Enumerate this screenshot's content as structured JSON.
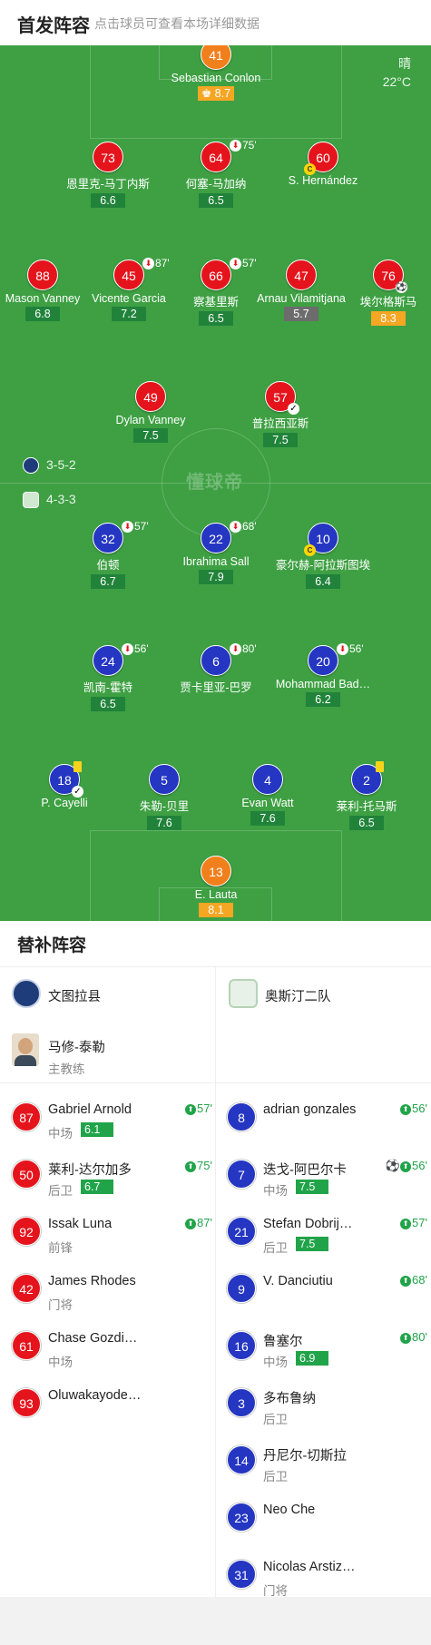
{
  "header": {
    "title": "首发阵容",
    "subtitle": "点击球员可查看本场详细数据"
  },
  "weather": {
    "condition": "晴",
    "temperature": "22°C"
  },
  "watermark": "懂球帝",
  "formations": {
    "home": "3-5-2",
    "away": "4-3-3"
  },
  "home_players": [
    {
      "num": "41",
      "name": "Sebastian Conlon",
      "rating": "8.7"
    },
    {
      "num": "73",
      "name": "恩里克-马丁内斯",
      "rating": "6.6"
    },
    {
      "num": "64",
      "name": "何塞-马加纳",
      "rating": "6.5",
      "sub": "75'"
    },
    {
      "num": "60",
      "name": "S. Hernández"
    },
    {
      "num": "88",
      "name": "Mason Vanney",
      "rating": "6.8"
    },
    {
      "num": "45",
      "name": "Vicente Garcia",
      "rating": "7.2",
      "sub": "87'"
    },
    {
      "num": "66",
      "name": "察基里斯",
      "rating": "6.5",
      "sub": "57'"
    },
    {
      "num": "47",
      "name": "Arnau Vilamitjana",
      "rating": "5.7"
    },
    {
      "num": "76",
      "name": "埃尔格斯马",
      "rating": "8.3"
    },
    {
      "num": "49",
      "name": "Dylan Vanney",
      "rating": "7.5"
    },
    {
      "num": "57",
      "name": "普拉西亚斯",
      "rating": "7.5"
    }
  ],
  "away_players": [
    {
      "num": "32",
      "name": "伯顿",
      "rating": "6.7",
      "sub": "57'"
    },
    {
      "num": "22",
      "name": "Ibrahima Sall",
      "rating": "7.9",
      "sub": "68'"
    },
    {
      "num": "10",
      "name": "豪尔赫-阿拉斯图埃",
      "rating": "6.4"
    },
    {
      "num": "24",
      "name": "凯南-霍特",
      "rating": "6.5",
      "sub": "56'"
    },
    {
      "num": "6",
      "name": "贾卡里亚-巴罗",
      "sub": "80'"
    },
    {
      "num": "20",
      "name": "Mohammad Bad…",
      "rating": "6.2",
      "sub": "56'"
    },
    {
      "num": "18",
      "name": "P. Cayelli"
    },
    {
      "num": "5",
      "name": "朱勒-贝里",
      "rating": "7.6"
    },
    {
      "num": "4",
      "name": "Evan Watt",
      "rating": "7.6"
    },
    {
      "num": "2",
      "name": "莱利-托马斯",
      "rating": "6.5"
    },
    {
      "num": "13",
      "name": "E. Lauta",
      "rating": "8.1"
    }
  ],
  "captain_mark": "C",
  "subs": {
    "title": "替补阵容",
    "home_team": "文图拉县",
    "away_team": "奥斯汀二队",
    "coach": {
      "name": "马修-泰勒",
      "role": "主教练"
    },
    "home": [
      {
        "num": "87",
        "name": "Gabriel Arnold",
        "pos": "中场",
        "rating": "6.1",
        "min": "57'"
      },
      {
        "num": "50",
        "name": "莱利-达尔加多",
        "pos": "后卫",
        "rating": "6.7",
        "min": "75'"
      },
      {
        "num": "92",
        "name": "Issak Luna",
        "pos": "前锋",
        "min": "87'"
      },
      {
        "num": "42",
        "name": "James Rhodes",
        "pos": "门将"
      },
      {
        "num": "61",
        "name": "Chase Gozdi…",
        "pos": "中场"
      },
      {
        "num": "93",
        "name": "Oluwakayode…"
      }
    ],
    "away": [
      {
        "num": "8",
        "name": "adrian gonzales",
        "min": "56'"
      },
      {
        "num": "7",
        "name": "迭戈-阿巴尔卡",
        "pos": "中场",
        "rating": "7.5",
        "min": "56'"
      },
      {
        "num": "21",
        "name": "Stefan Dobrij…",
        "pos": "后卫",
        "rating": "7.5",
        "min": "57'"
      },
      {
        "num": "9",
        "name": "V. Danciutiu",
        "min": "68'"
      },
      {
        "num": "16",
        "name": "鲁塞尔",
        "pos": "中场",
        "rating": "6.9",
        "min": "80'"
      },
      {
        "num": "3",
        "name": "多布鲁纳",
        "pos": "后卫"
      },
      {
        "num": "14",
        "name": "丹尼尔-切斯拉",
        "pos": "后卫"
      },
      {
        "num": "23",
        "name": "Neo Che"
      },
      {
        "num": "31",
        "name": "Nicolas Arstiz…",
        "pos": "门将"
      }
    ]
  },
  "colors": {
    "pitch": "#3ea043",
    "home": "#e5141c",
    "away": "#2436c2",
    "keeper": "#f17f1c",
    "rating": "#21833a",
    "best_rating": "#f5a623",
    "low_rating": "#6c6c6c",
    "sub_in": "#21a449"
  },
  "icons": {
    "sub_out": "sub-out-icon",
    "sub_in": "sub-in-icon",
    "goal": "football-icon",
    "yellow_card": "yellow-card-icon",
    "captain": "captain-badge"
  }
}
